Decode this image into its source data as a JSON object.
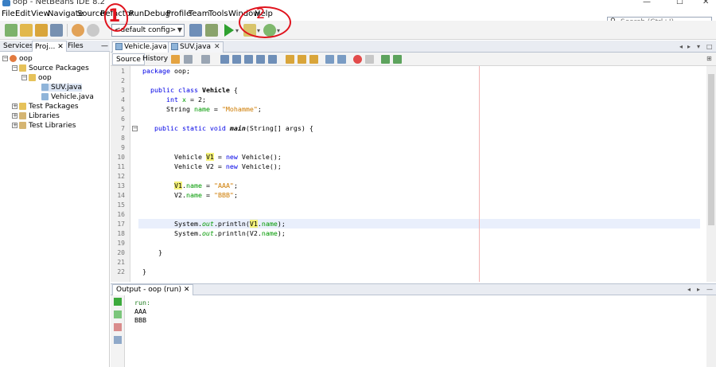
{
  "window": {
    "title": "oop - NetBeans IDE 8.2",
    "minimize": "—",
    "maximize": "☐",
    "close": "✕"
  },
  "menu": [
    "File",
    "Edit",
    "View",
    "Navigate",
    "Source",
    "Refactor",
    "Run",
    "Debug",
    "Profile",
    "Team",
    "Tools",
    "Window",
    "Help"
  ],
  "search": {
    "placeholder": "Search (Ctrl+I)"
  },
  "toolbar": {
    "config_value": "<default config>"
  },
  "annotations": {
    "one": "1",
    "two": "2"
  },
  "left_panel": {
    "tabs": [
      "Services",
      "Proj...",
      "Files"
    ],
    "tab_close": "✕",
    "minimize": "—",
    "tree": [
      {
        "label": "oop",
        "level": 0,
        "toggle": "−"
      },
      {
        "label": "Source Packages",
        "level": 1,
        "toggle": "−"
      },
      {
        "label": "oop",
        "level": 2,
        "toggle": "−"
      },
      {
        "label": "SUV.java",
        "level": 3,
        "toggle": ""
      },
      {
        "label": "Vehicle.java",
        "level": 3,
        "toggle": ""
      },
      {
        "label": "Test Packages",
        "level": 1,
        "toggle": "+"
      },
      {
        "label": "Libraries",
        "level": 1,
        "toggle": "+"
      },
      {
        "label": "Test Libraries",
        "level": 1,
        "toggle": "+"
      }
    ]
  },
  "editor": {
    "tabs": [
      {
        "label": "Vehicle.java",
        "close": "✕",
        "active": true
      },
      {
        "label": "SUV.java",
        "close": "✕",
        "active": false
      }
    ],
    "views": [
      "Source",
      "History"
    ],
    "line_numbers": [
      "1",
      "2",
      "3",
      "4",
      "5",
      "6",
      "7",
      "8",
      "9",
      "10",
      "11",
      "12",
      "13",
      "14",
      "15",
      "16",
      "17",
      "18",
      "19",
      "20",
      "21",
      "22"
    ],
    "code": {
      "l1_kw": "package",
      "l1_rest": " oop;",
      "l3_kw": "public class",
      "l3_cls": " Vehicle ",
      "l3_brace": "{",
      "l4_kw": "int",
      "l4_fld": " x",
      "l4_rest": " = 2;",
      "l5_type": "String ",
      "l5_fld": "name",
      "l5_eq": " = ",
      "l5_str": "\"Mohamme\"",
      "l5_end": ";",
      "l7_kw": "public static void",
      "l7_meth": " main",
      "l7_rest": "(String[] args) {",
      "l10_a": "Vehicle ",
      "l10_var": "V1",
      "l10_b": " = ",
      "l10_kw": "new",
      "l10_c": " Vehicle();",
      "l11_a": "Vehicle V2 = ",
      "l11_kw": "new",
      "l11_c": " Vehicle();",
      "l13_var": "V1",
      "l13_dot": ".",
      "l13_fld": "name",
      "l13_eq": " = ",
      "l13_str": "\"AAA\"",
      "l13_end": ";",
      "l14_a": "V2.",
      "l14_fld": "name",
      "l14_eq": " = ",
      "l14_str": "\"BBB\"",
      "l14_end": ";",
      "l17_a": "System.",
      "l17_out": "out",
      "l17_b": ".println(",
      "l17_var": "V1",
      "l17_c": ".",
      "l17_fld": "name",
      "l17_d": ");",
      "l18_a": "System.",
      "l18_out": "out",
      "l18_b": ".println(V2.",
      "l18_fld": "name",
      "l18_d": ");",
      "l20": "}",
      "l22": "}"
    }
  },
  "output": {
    "tab_label": "Output - oop (run)",
    "tab_close": "✕",
    "lines": [
      "run:",
      "AAA",
      "BBB"
    ]
  },
  "colors": {
    "keyword": "#0000e6",
    "string": "#ce7b00",
    "field": "#009900",
    "annotation": "#e0141e"
  }
}
